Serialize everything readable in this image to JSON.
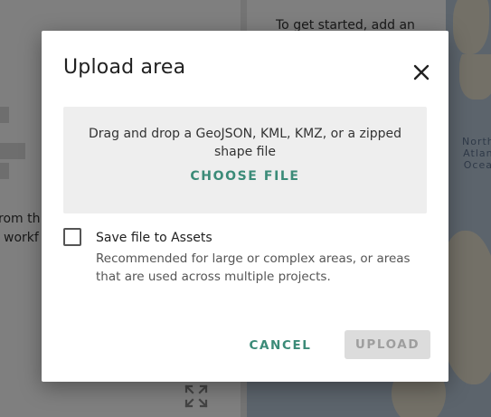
{
  "background": {
    "intro_text": "To get started, add an",
    "left_text_line1": "rom th",
    "left_text_line2": "workf",
    "map_labels": {
      "ocean_line1": "North",
      "ocean_line2": "Atlan",
      "ocean_line3": "Ocea"
    },
    "icons": {
      "expand": "expand-arrows-icon"
    }
  },
  "dialog": {
    "title": "Upload area",
    "close_icon": "close-icon",
    "dropzone": {
      "instructions": "Drag and drop a GeoJSON, KML, KMZ, or a zipped shape file",
      "choose_file_label": "CHOOSE FILE"
    },
    "save_option": {
      "checked": false,
      "label": "Save file to Assets",
      "description": "Recommended for large or complex areas, or areas that are used across multiple projects."
    },
    "actions": {
      "cancel_label": "CANCEL",
      "upload_label": "UPLOAD",
      "upload_enabled": false
    }
  },
  "colors": {
    "accent": "#3b8b78",
    "scrim": "rgba(0,0,0,0.5)",
    "disabled_bg": "#dcdcdc",
    "disabled_text": "#9e9e9e",
    "dropzone_bg": "#eeeeee",
    "ocean": "#b9c9d9",
    "land": "#e7e1cf"
  }
}
